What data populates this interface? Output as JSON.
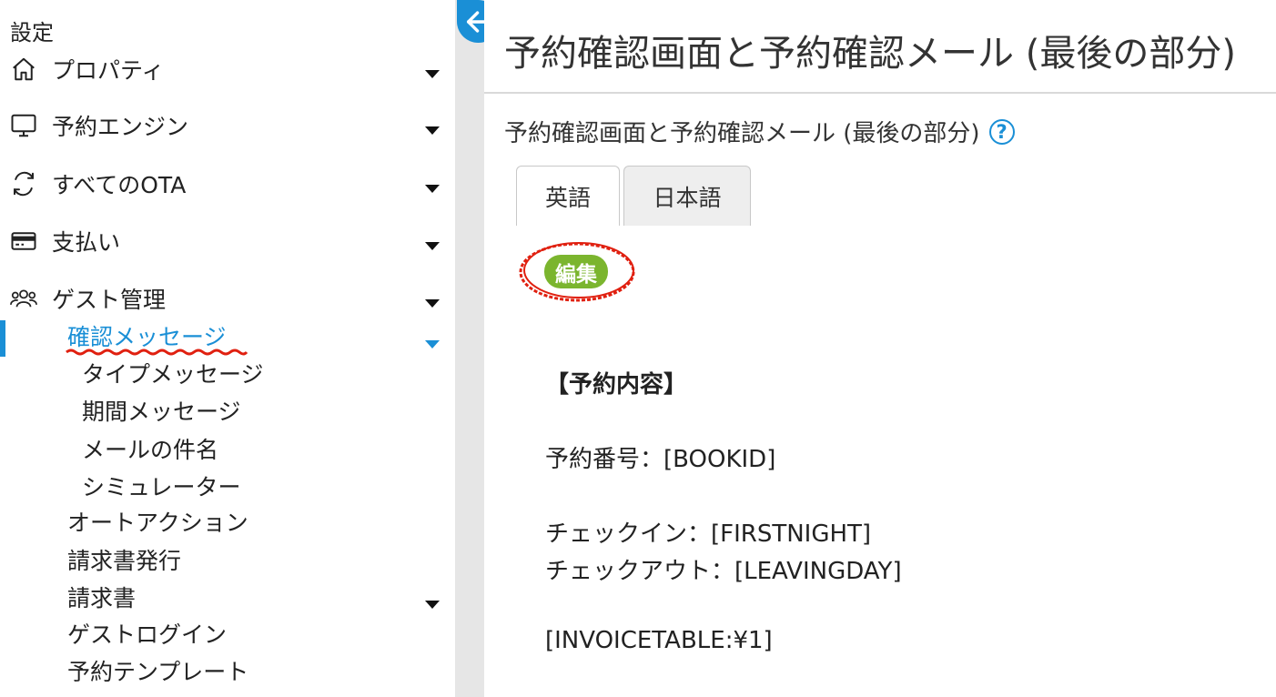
{
  "sidebar": {
    "title": "設定",
    "items": [
      {
        "label": "プロパティ",
        "icon": "home-icon"
      },
      {
        "label": "予約エンジン",
        "icon": "monitor-icon"
      },
      {
        "label": "すべてのOTA",
        "icon": "sync-icon"
      },
      {
        "label": "支払い",
        "icon": "credit-card-icon"
      },
      {
        "label": "ゲスト管理",
        "icon": "users-icon"
      }
    ],
    "guest_sub": {
      "active": "確認メッセージ",
      "active_children": [
        "タイプメッセージ",
        "期間メッセージ",
        "メールの件名",
        "シミュレーター"
      ],
      "others": [
        "オートアクション",
        "請求書発行",
        "請求書",
        "ゲストログイン",
        "予約テンプレート"
      ]
    }
  },
  "main": {
    "page_title": "予約確認画面と予約確認メール (最後の部分)",
    "section_title": "予約確認画面と予約確認メール (最後の部分)",
    "help_symbol": "?",
    "tabs": [
      {
        "label": "英語",
        "active": true
      },
      {
        "label": "日本語",
        "active": false
      }
    ],
    "edit_label": "編集",
    "content": {
      "heading": "【予約内容】",
      "booking_id": "予約番号：[BOOKID]",
      "checkin": "チェックイン：[FIRSTNIGHT]",
      "checkout": "チェックアウト：[LEAVINGDAY]",
      "invoice": "[INVOICETABLE:¥1]"
    }
  },
  "colors": {
    "accent": "#1a8fd6",
    "edit_button": "#7bb52e",
    "annotation": "#e02010",
    "gutter": "#e6e6e6"
  }
}
